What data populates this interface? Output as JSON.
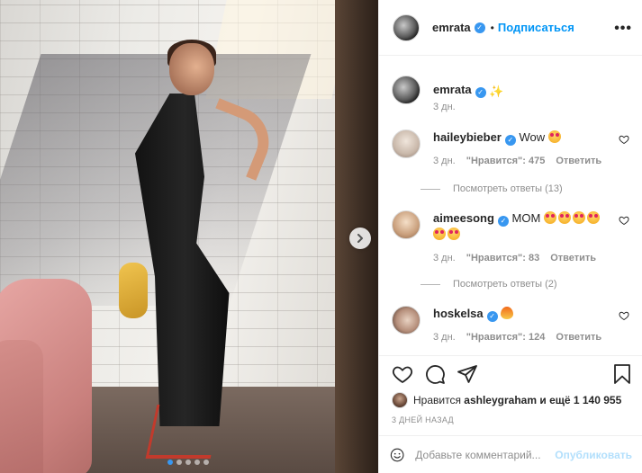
{
  "post": {
    "author": "emrata",
    "follow_separator": "•",
    "follow_label": "Подписаться",
    "more_label": "•••",
    "image_slide_count": 5,
    "active_slide_index": 0
  },
  "caption": {
    "author": "emrata",
    "emoji": "sparkles",
    "time": "3 дн."
  },
  "comments": [
    {
      "user": "haileybieber",
      "text": "Wow",
      "emojis": [
        "heart-eyes"
      ],
      "time": "3 дн.",
      "likes": "\"Нравится\": 475",
      "reply_label": "Ответить",
      "view_replies": "Посмотреть ответы (13)"
    },
    {
      "user": "aimeesong",
      "text": "MOM",
      "emojis": [
        "heart-eyes",
        "heart-eyes",
        "heart-eyes",
        "heart-eyes",
        "heart-eyes",
        "heart-eyes"
      ],
      "time": "3 дн.",
      "likes": "\"Нравится\": 83",
      "reply_label": "Ответить",
      "view_replies": "Посмотреть ответы (2)"
    },
    {
      "user": "hoskelsa",
      "text": "",
      "emojis": [
        "fire"
      ],
      "time": "3 дн.",
      "likes": "\"Нравится\": 124",
      "reply_label": "Ответить"
    }
  ],
  "likes_summary": {
    "prefix": "Нравится",
    "user": "ashleygraham",
    "suffix": "и ещё 1 140 955"
  },
  "time_ago": "3 ДНЕЙ НАЗАД",
  "add_comment": {
    "placeholder": "Добавьте комментарий...",
    "publish_label": "Опубликовать"
  },
  "icons": {
    "like": "heart-icon",
    "comment": "comment-icon",
    "share": "paper-plane-icon",
    "save": "bookmark-icon",
    "emoji": "smiley-icon",
    "next": "chevron-right-icon"
  },
  "colors": {
    "link_blue": "#0095f6",
    "verified_blue": "#3897f0",
    "muted_text": "#8e8e8e",
    "publish_disabled": "#b2dffc"
  }
}
